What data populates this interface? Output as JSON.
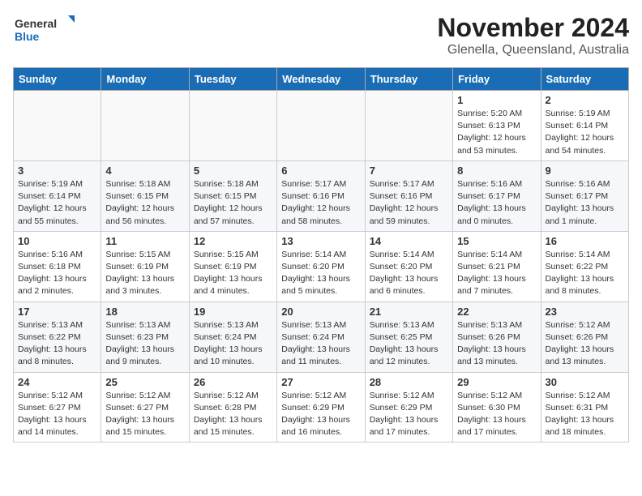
{
  "header": {
    "logo_general": "General",
    "logo_blue": "Blue",
    "main_title": "November 2024",
    "subtitle": "Glenella, Queensland, Australia"
  },
  "calendar": {
    "weekdays": [
      "Sunday",
      "Monday",
      "Tuesday",
      "Wednesday",
      "Thursday",
      "Friday",
      "Saturday"
    ],
    "weeks": [
      [
        {
          "day": "",
          "detail": ""
        },
        {
          "day": "",
          "detail": ""
        },
        {
          "day": "",
          "detail": ""
        },
        {
          "day": "",
          "detail": ""
        },
        {
          "day": "",
          "detail": ""
        },
        {
          "day": "1",
          "detail": "Sunrise: 5:20 AM\nSunset: 6:13 PM\nDaylight: 12 hours\nand 53 minutes."
        },
        {
          "day": "2",
          "detail": "Sunrise: 5:19 AM\nSunset: 6:14 PM\nDaylight: 12 hours\nand 54 minutes."
        }
      ],
      [
        {
          "day": "3",
          "detail": "Sunrise: 5:19 AM\nSunset: 6:14 PM\nDaylight: 12 hours\nand 55 minutes."
        },
        {
          "day": "4",
          "detail": "Sunrise: 5:18 AM\nSunset: 6:15 PM\nDaylight: 12 hours\nand 56 minutes."
        },
        {
          "day": "5",
          "detail": "Sunrise: 5:18 AM\nSunset: 6:15 PM\nDaylight: 12 hours\nand 57 minutes."
        },
        {
          "day": "6",
          "detail": "Sunrise: 5:17 AM\nSunset: 6:16 PM\nDaylight: 12 hours\nand 58 minutes."
        },
        {
          "day": "7",
          "detail": "Sunrise: 5:17 AM\nSunset: 6:16 PM\nDaylight: 12 hours\nand 59 minutes."
        },
        {
          "day": "8",
          "detail": "Sunrise: 5:16 AM\nSunset: 6:17 PM\nDaylight: 13 hours\nand 0 minutes."
        },
        {
          "day": "9",
          "detail": "Sunrise: 5:16 AM\nSunset: 6:17 PM\nDaylight: 13 hours\nand 1 minute."
        }
      ],
      [
        {
          "day": "10",
          "detail": "Sunrise: 5:16 AM\nSunset: 6:18 PM\nDaylight: 13 hours\nand 2 minutes."
        },
        {
          "day": "11",
          "detail": "Sunrise: 5:15 AM\nSunset: 6:19 PM\nDaylight: 13 hours\nand 3 minutes."
        },
        {
          "day": "12",
          "detail": "Sunrise: 5:15 AM\nSunset: 6:19 PM\nDaylight: 13 hours\nand 4 minutes."
        },
        {
          "day": "13",
          "detail": "Sunrise: 5:14 AM\nSunset: 6:20 PM\nDaylight: 13 hours\nand 5 minutes."
        },
        {
          "day": "14",
          "detail": "Sunrise: 5:14 AM\nSunset: 6:20 PM\nDaylight: 13 hours\nand 6 minutes."
        },
        {
          "day": "15",
          "detail": "Sunrise: 5:14 AM\nSunset: 6:21 PM\nDaylight: 13 hours\nand 7 minutes."
        },
        {
          "day": "16",
          "detail": "Sunrise: 5:14 AM\nSunset: 6:22 PM\nDaylight: 13 hours\nand 8 minutes."
        }
      ],
      [
        {
          "day": "17",
          "detail": "Sunrise: 5:13 AM\nSunset: 6:22 PM\nDaylight: 13 hours\nand 8 minutes."
        },
        {
          "day": "18",
          "detail": "Sunrise: 5:13 AM\nSunset: 6:23 PM\nDaylight: 13 hours\nand 9 minutes."
        },
        {
          "day": "19",
          "detail": "Sunrise: 5:13 AM\nSunset: 6:24 PM\nDaylight: 13 hours\nand 10 minutes."
        },
        {
          "day": "20",
          "detail": "Sunrise: 5:13 AM\nSunset: 6:24 PM\nDaylight: 13 hours\nand 11 minutes."
        },
        {
          "day": "21",
          "detail": "Sunrise: 5:13 AM\nSunset: 6:25 PM\nDaylight: 13 hours\nand 12 minutes."
        },
        {
          "day": "22",
          "detail": "Sunrise: 5:13 AM\nSunset: 6:26 PM\nDaylight: 13 hours\nand 13 minutes."
        },
        {
          "day": "23",
          "detail": "Sunrise: 5:12 AM\nSunset: 6:26 PM\nDaylight: 13 hours\nand 13 minutes."
        }
      ],
      [
        {
          "day": "24",
          "detail": "Sunrise: 5:12 AM\nSunset: 6:27 PM\nDaylight: 13 hours\nand 14 minutes."
        },
        {
          "day": "25",
          "detail": "Sunrise: 5:12 AM\nSunset: 6:27 PM\nDaylight: 13 hours\nand 15 minutes."
        },
        {
          "day": "26",
          "detail": "Sunrise: 5:12 AM\nSunset: 6:28 PM\nDaylight: 13 hours\nand 15 minutes."
        },
        {
          "day": "27",
          "detail": "Sunrise: 5:12 AM\nSunset: 6:29 PM\nDaylight: 13 hours\nand 16 minutes."
        },
        {
          "day": "28",
          "detail": "Sunrise: 5:12 AM\nSunset: 6:29 PM\nDaylight: 13 hours\nand 17 minutes."
        },
        {
          "day": "29",
          "detail": "Sunrise: 5:12 AM\nSunset: 6:30 PM\nDaylight: 13 hours\nand 17 minutes."
        },
        {
          "day": "30",
          "detail": "Sunrise: 5:12 AM\nSunset: 6:31 PM\nDaylight: 13 hours\nand 18 minutes."
        }
      ]
    ]
  }
}
